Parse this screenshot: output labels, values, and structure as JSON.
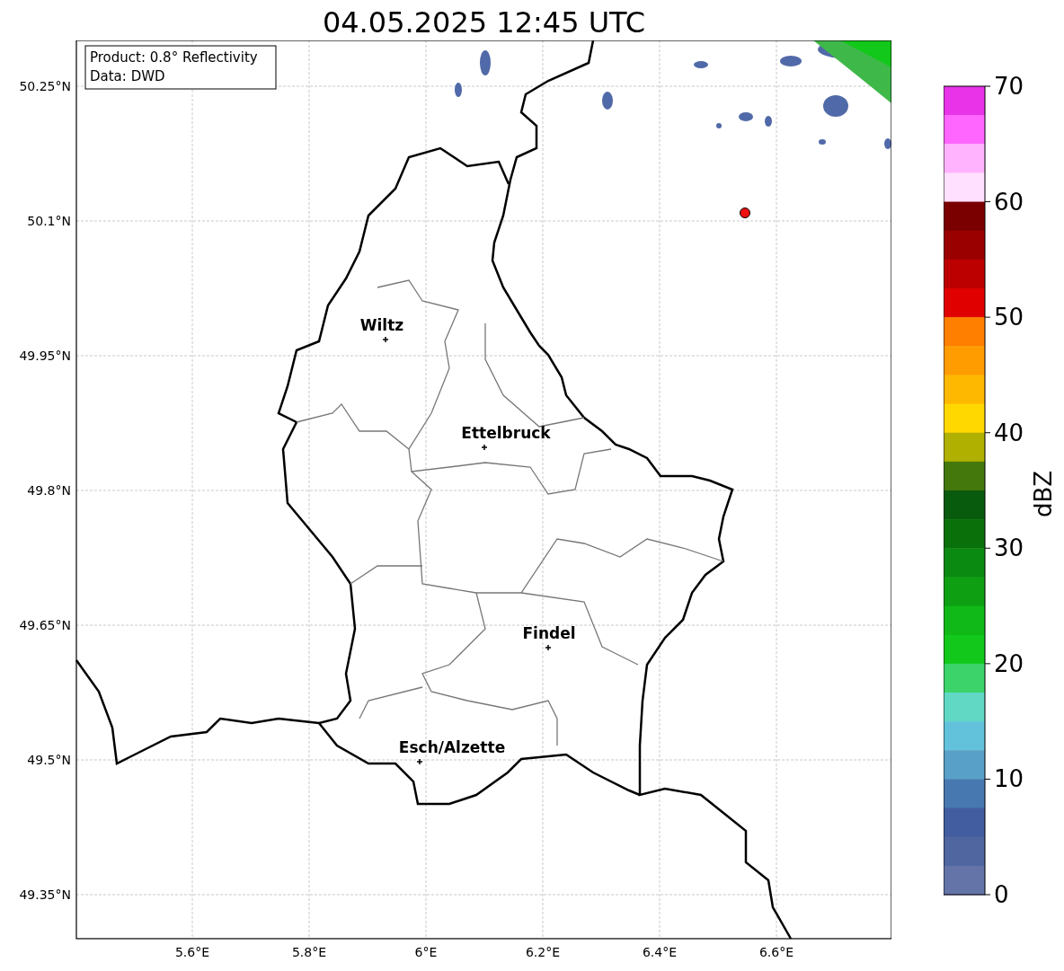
{
  "title": "04.05.2025 12:45 UTC",
  "info_box": [
    "Product: 0.8° Reflectivity",
    "Data: DWD"
  ],
  "map": {
    "latitude_labels": [
      "50.25°N",
      "50.1°N",
      "49.95°N",
      "49.8°N",
      "49.65°N",
      "49.5°N",
      "49.35°N"
    ],
    "longitude_labels": [
      "5.6°E",
      "5.8°E",
      "6°E",
      "6.2°E",
      "6.4°E",
      "6.6°E"
    ],
    "cities": [
      {
        "name": "Wiltz"
      },
      {
        "name": "Ettelbruck"
      },
      {
        "name": "Findel"
      },
      {
        "name": "Esch/Alzette"
      }
    ],
    "radar_site": {
      "color": "#ee1111"
    }
  },
  "colorbar": {
    "label": "dBZ",
    "ticks": [
      "70",
      "60",
      "50",
      "40",
      "30",
      "20",
      "10",
      "0"
    ],
    "segments": [
      {
        "color": "#e833e8"
      },
      {
        "color": "#ff66ff"
      },
      {
        "color": "#ffb3ff"
      },
      {
        "color": "#ffe0ff"
      },
      {
        "color": "#7a0000"
      },
      {
        "color": "#9a0000"
      },
      {
        "color": "#bc0000"
      },
      {
        "color": "#e00000"
      },
      {
        "color": "#ff7f00"
      },
      {
        "color": "#ff9c00"
      },
      {
        "color": "#ffb800"
      },
      {
        "color": "#ffd800"
      },
      {
        "color": "#b0b000"
      },
      {
        "color": "#45780c"
      },
      {
        "color": "#085a0c"
      },
      {
        "color": "#0a700a"
      },
      {
        "color": "#0a8a10"
      },
      {
        "color": "#0ea012"
      },
      {
        "color": "#10b818"
      },
      {
        "color": "#12c81a"
      },
      {
        "color": "#3cd46a"
      },
      {
        "color": "#60d8c4"
      },
      {
        "color": "#62c2dc"
      },
      {
        "color": "#58a0c8"
      },
      {
        "color": "#4878b0"
      },
      {
        "color": "#425ea0"
      },
      {
        "color": "#5066a0"
      },
      {
        "color": "#6474a8"
      }
    ]
  }
}
